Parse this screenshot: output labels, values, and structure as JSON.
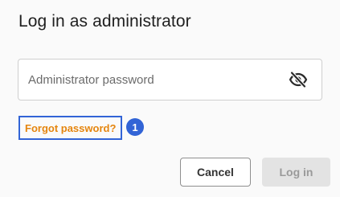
{
  "dialog": {
    "title": "Log in as administrator",
    "password_field": {
      "placeholder": "Administrator password",
      "value": "",
      "visibility_icon": "eye-slash-icon"
    },
    "forgot_link": "Forgot password?",
    "step_badge": "1",
    "cancel_label": "Cancel",
    "login_label": "Log in",
    "login_enabled": false
  },
  "colors": {
    "accent_blue": "#3264d6",
    "link_orange": "#e5850e",
    "disabled_button_bg": "#e3e3e3",
    "disabled_button_text": "#9a9a9a"
  }
}
